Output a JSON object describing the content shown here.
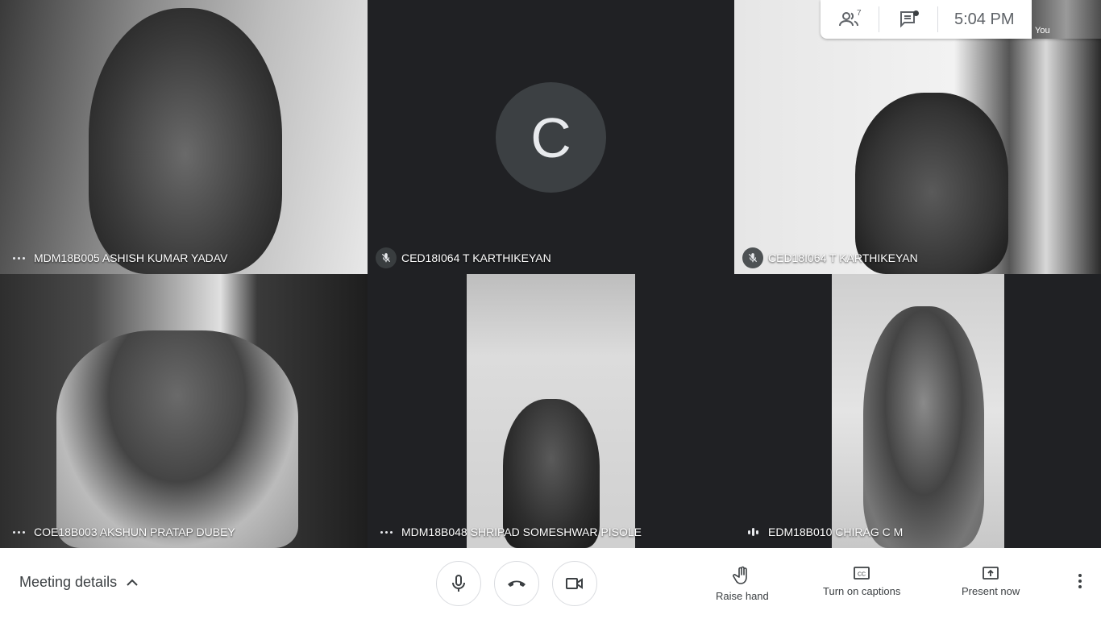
{
  "participants": [
    {
      "name": "MDM18B005 ASHISH KUMAR YADAV",
      "status": "more"
    },
    {
      "name": "CED18I064 T KARTHIKEYAN",
      "status": "muted",
      "avatar_letter": "C"
    },
    {
      "name": "CED18I064 T KARTHIKEYAN",
      "status": "muted"
    },
    {
      "name": "COE18B003 AKSHUN PRATAP DUBEY",
      "status": "more"
    },
    {
      "name": "MDM18B048 SHRIPAD SOMESHWAR PISOLE",
      "status": "more"
    },
    {
      "name": "EDM18B010 CHIRAG C M",
      "status": "speaking"
    }
  ],
  "topbar": {
    "participant_count": "7",
    "time": "5:04  PM",
    "self_label": "You",
    "icons": [
      "people-icon",
      "chat-icon"
    ]
  },
  "bottombar": {
    "meeting_details": "Meeting details",
    "raise_hand": "Raise hand",
    "captions": "Turn on captions",
    "present": "Present now",
    "icons": [
      "mic-icon",
      "hang-up-icon",
      "camera-icon",
      "hand-icon",
      "captions-icon",
      "present-icon",
      "more-vert-icon"
    ]
  },
  "colors": {
    "background": "#202124",
    "bar": "#ffffff",
    "icon": "#3c4043",
    "hangup": "#3c4043"
  }
}
